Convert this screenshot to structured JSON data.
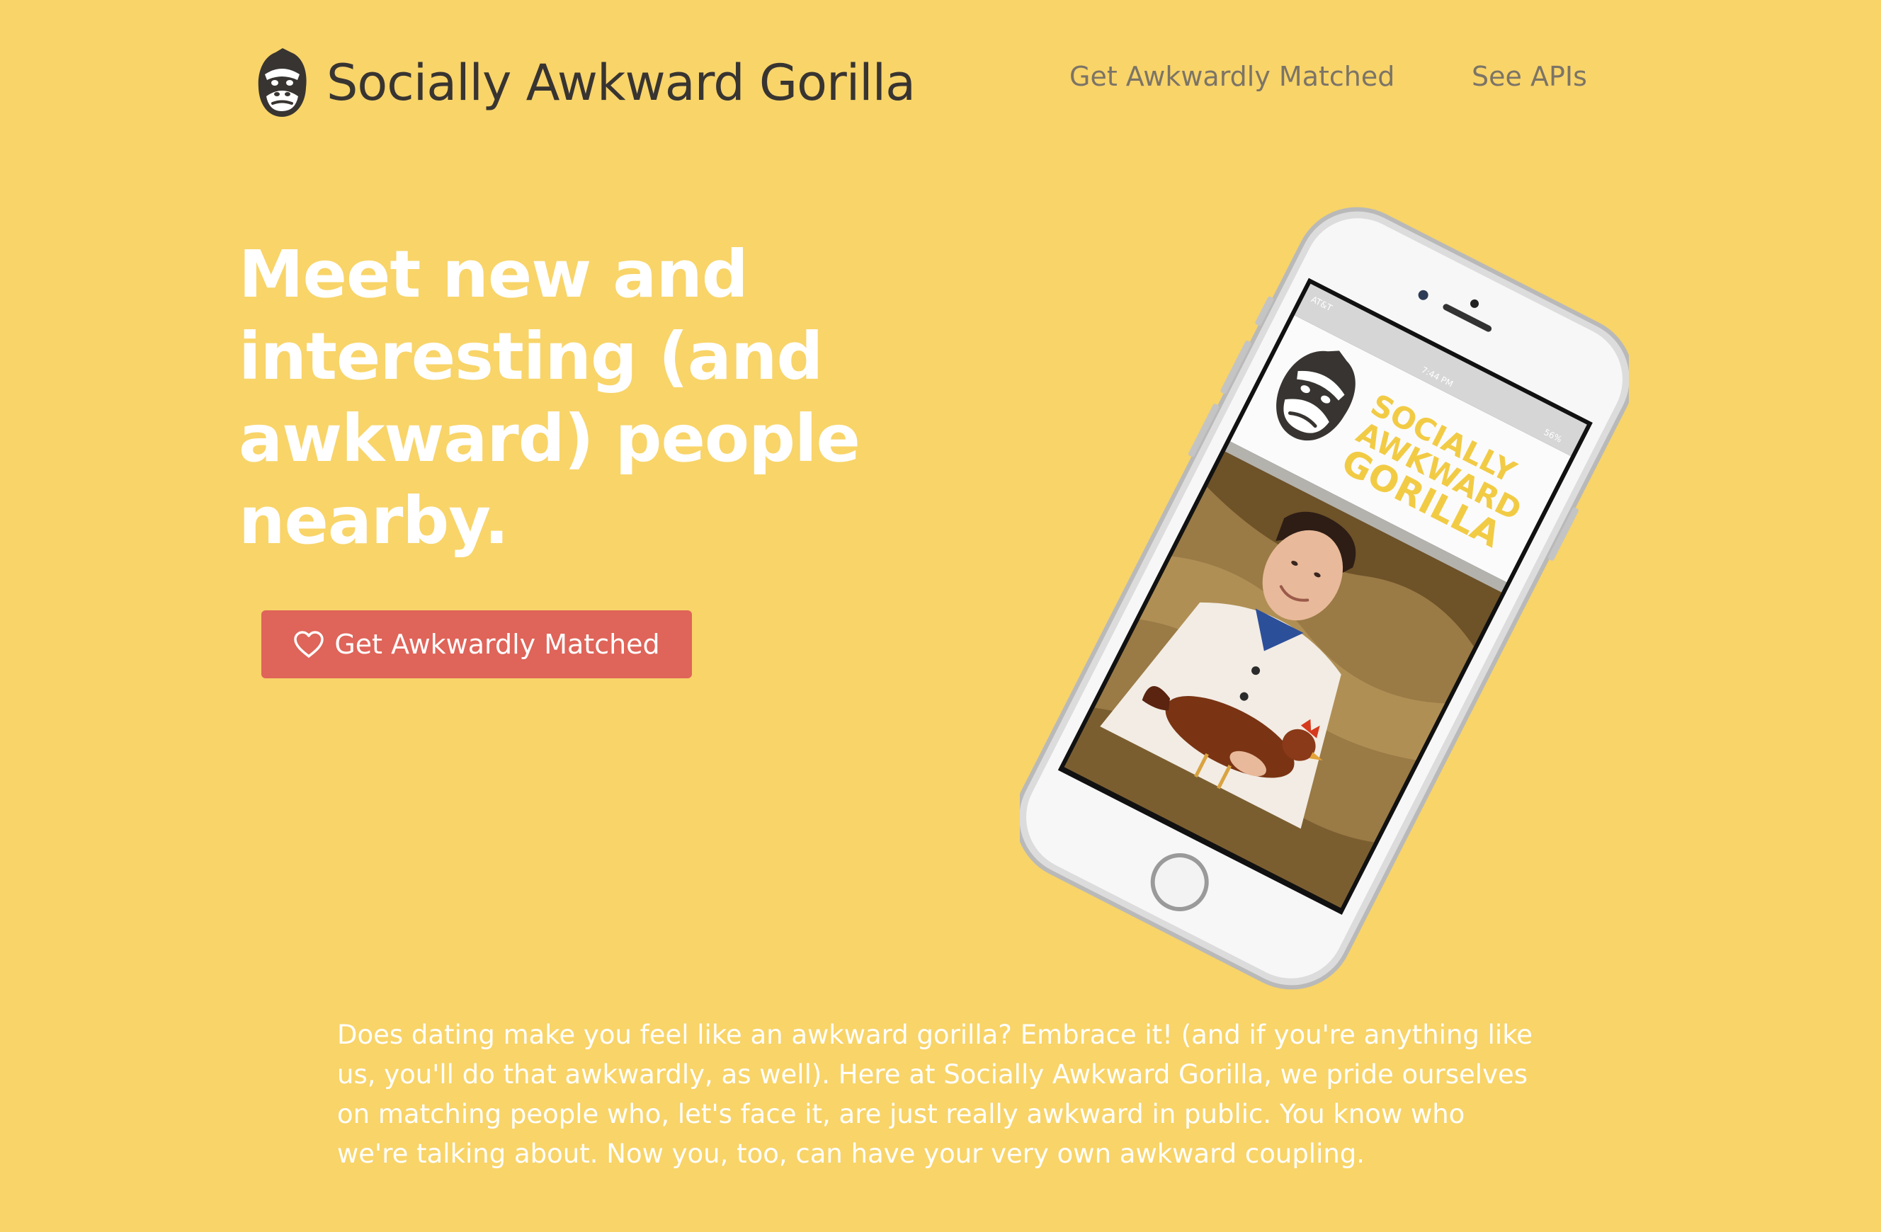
{
  "header": {
    "brand_name": "Socially Awkward Gorilla",
    "nav": [
      {
        "label": "Get Awkwardly Matched"
      },
      {
        "label": "See APIs"
      }
    ]
  },
  "hero": {
    "headline": "Meet new and interesting (and awkward) people nearby.",
    "cta_label": "Get Awkwardly Matched",
    "cta_icon": "heart-icon"
  },
  "phone": {
    "carrier": "AT&T",
    "time": "7:44 PM",
    "battery": "56%",
    "app_logo_lines": [
      "SOCIALLY",
      "AWKWARD",
      "GORILLA"
    ]
  },
  "description": "Does dating make you feel like an awkward gorilla? Embrace it! (and if you're anything like us, you'll do that awkwardly, as well). Here at Socially Awkward Gorilla, we pride ourselves on matching people who, let's face it, are just really awkward in public. You know who we're talking about. Now you, too, can have your very own awkward coupling.",
  "colors": {
    "background": "#f8d469",
    "brand_text": "#383431",
    "nav_text": "#7c7466",
    "headline_text": "#ffffff",
    "cta_background": "#df6459",
    "app_logo_text": "#f2cb45"
  }
}
